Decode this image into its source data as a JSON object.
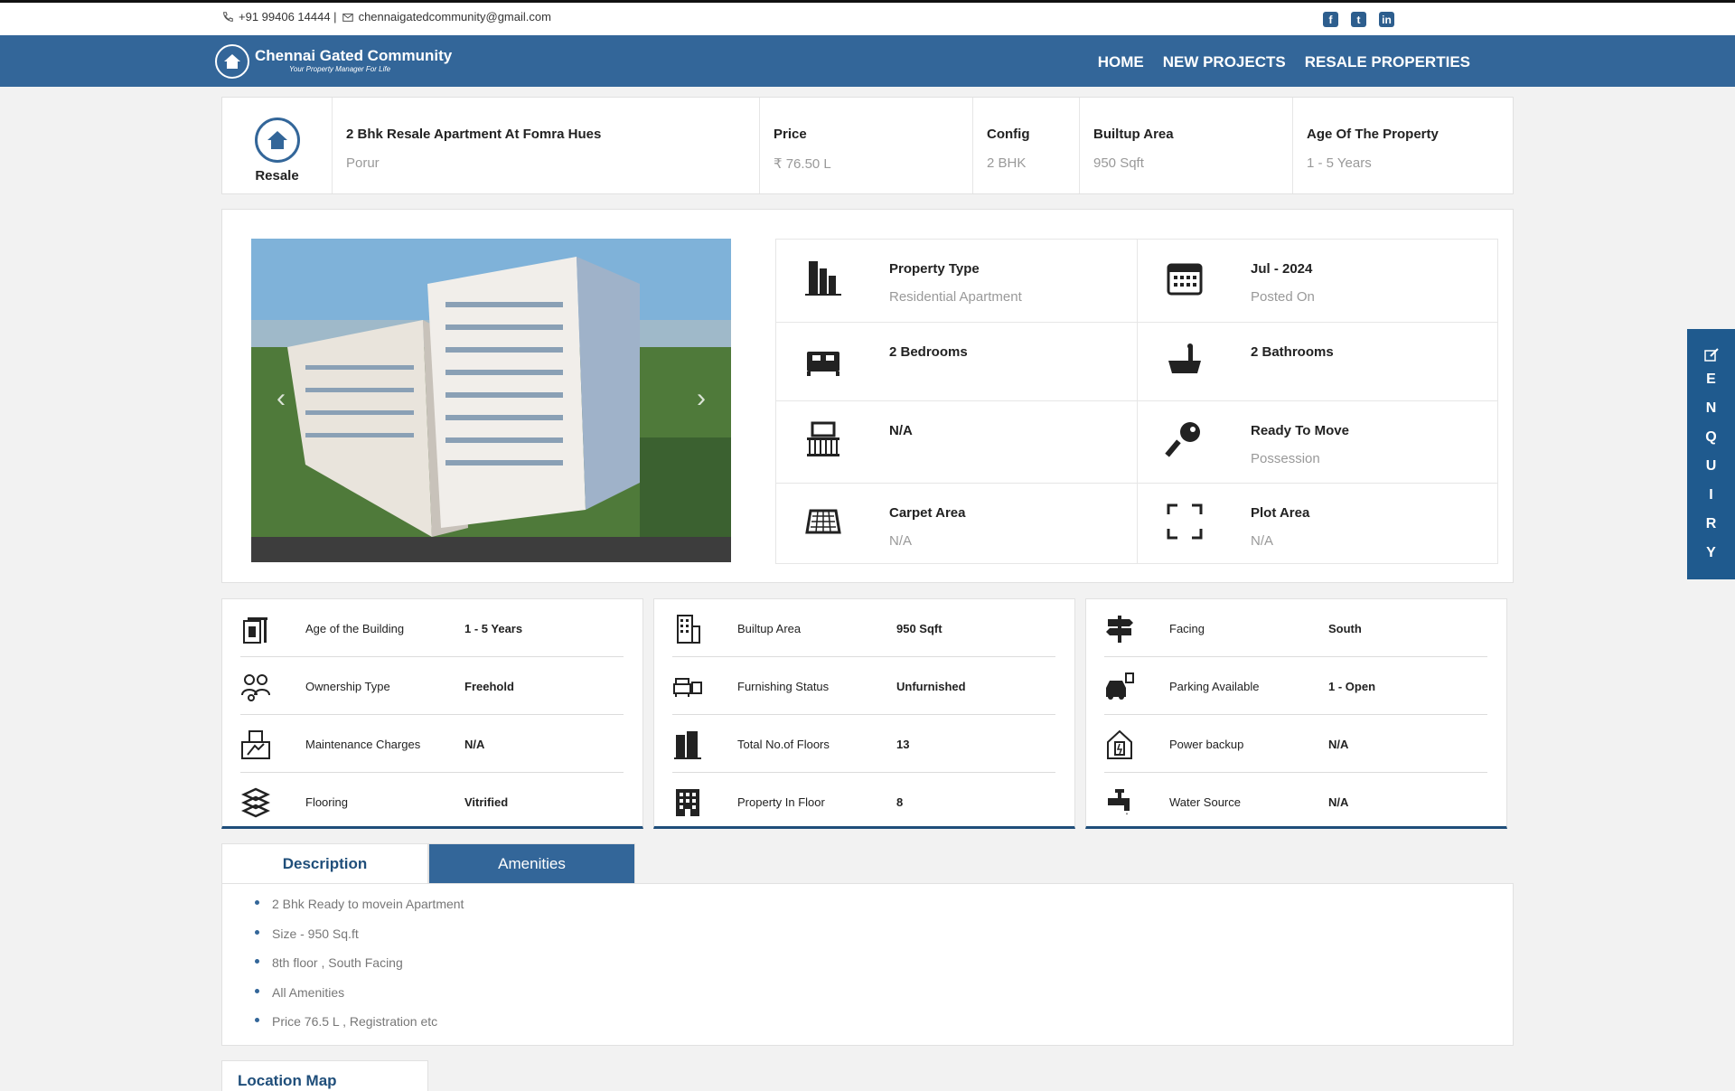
{
  "contact": {
    "phone": "+91 99406 14444 |",
    "email": "chennaigatedcommunity@gmail.com"
  },
  "social": [
    "facebook-icon",
    "twitter-icon",
    "linkedin-icon"
  ],
  "brand": {
    "name": "Chennai Gated Community",
    "tagline": "Your Property Manager For Life"
  },
  "nav": {
    "items": [
      "HOME",
      "NEW PROJECTS",
      "RESALE PROPERTIES"
    ]
  },
  "colors": {
    "primary": "#336699",
    "dark": "#1f4e7a",
    "muted": "#999999"
  },
  "summary": {
    "badge": "Resale",
    "title": "2 Bhk Resale Apartment At Fomra Hues",
    "location": "Porur",
    "cols": [
      {
        "label": "Price",
        "value": "₹ 76.50 L"
      },
      {
        "label": "Config",
        "value": "2 BHK"
      },
      {
        "label": "Builtup Area",
        "value": "950 Sqft"
      },
      {
        "label": "Age Of The Property",
        "value": "1 - 5 Years"
      }
    ]
  },
  "features": [
    {
      "icon": "building-icon",
      "title": "Property Type",
      "sub": "Residential Apartment"
    },
    {
      "icon": "calendar-icon",
      "title": "Jul - 2024",
      "sub": "Posted On"
    },
    {
      "icon": "bed-icon",
      "title": "2 Bedrooms",
      "sub": ""
    },
    {
      "icon": "bathtub-icon",
      "title": "2 Bathrooms",
      "sub": ""
    },
    {
      "icon": "balcony-icon",
      "title": "N/A",
      "sub": ""
    },
    {
      "icon": "key-icon",
      "title": "Ready To Move",
      "sub": "Possession"
    },
    {
      "icon": "carpet-icon",
      "title": "Carpet Area",
      "sub": "N/A"
    },
    {
      "icon": "plot-area-icon",
      "title": "Plot Area",
      "sub": "N/A"
    }
  ],
  "details": [
    [
      {
        "icon": "building-age-icon",
        "label": "Age of the Building",
        "value": "1 - 5 Years"
      },
      {
        "icon": "ownership-icon",
        "label": "Ownership Type",
        "value": "Freehold"
      },
      {
        "icon": "maintenance-icon",
        "label": "Maintenance Charges",
        "value": "N/A"
      },
      {
        "icon": "flooring-icon",
        "label": "Flooring",
        "value": "Vitrified"
      }
    ],
    [
      {
        "icon": "builtup-icon",
        "label": "Builtup Area",
        "value": "950 Sqft"
      },
      {
        "icon": "furniture-icon",
        "label": "Furnishing Status",
        "value": "Unfurnished"
      },
      {
        "icon": "floors-icon",
        "label": "Total No.of Floors",
        "value": "13"
      },
      {
        "icon": "floor-building-icon",
        "label": "Property In Floor",
        "value": "8"
      }
    ],
    [
      {
        "icon": "signpost-icon",
        "label": "Facing",
        "value": "South"
      },
      {
        "icon": "parking-icon",
        "label": "Parking Available",
        "value": "1 - Open"
      },
      {
        "icon": "power-backup-icon",
        "label": "Power backup",
        "value": "N/A"
      },
      {
        "icon": "water-tap-icon",
        "label": "Water Source",
        "value": "N/A"
      }
    ]
  ],
  "tabs": {
    "description": "Description",
    "amenities": "Amenities"
  },
  "description": [
    "2 Bhk Ready to movein Apartment",
    "Size - 950 Sq.ft",
    "8th floor , South Facing",
    "All Amenities",
    "Price 76.5 L , Registration etc"
  ],
  "location_map": "Location Map",
  "enquiry": "ENQUIRY"
}
